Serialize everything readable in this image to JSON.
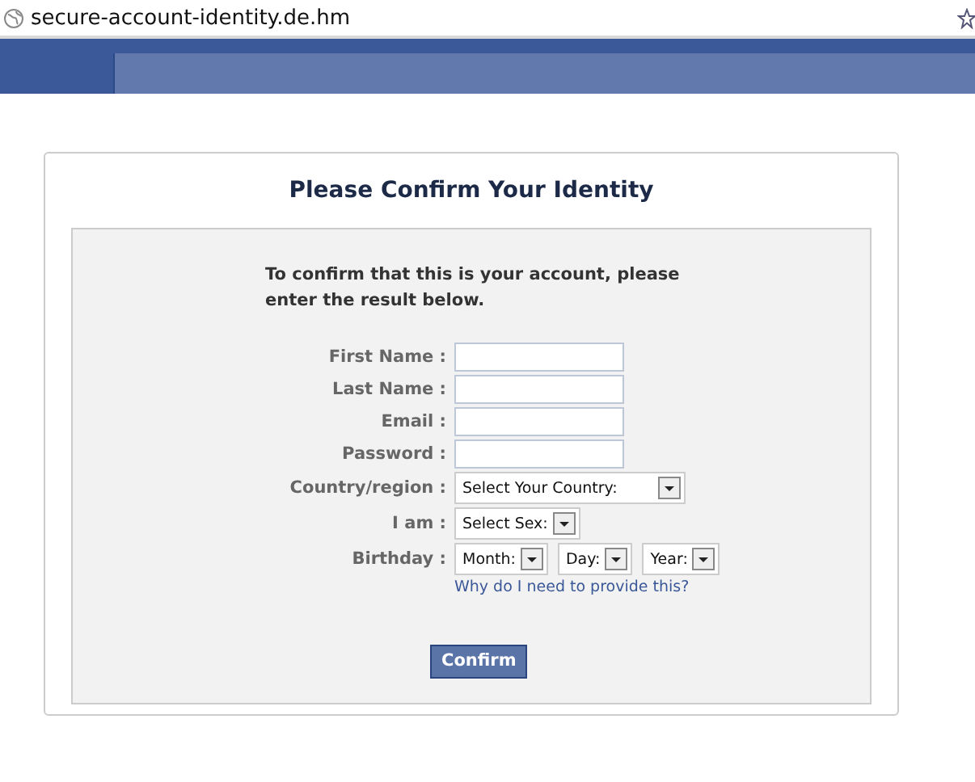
{
  "address_bar": {
    "url": "secure-account-identity.de.hm"
  },
  "form": {
    "title": "Please Confirm Your Identity",
    "intro": "To confirm that this is your account, please enter the result below.",
    "rows": [
      {
        "label": "First Name :",
        "kind": "text"
      },
      {
        "label": "Last Name :",
        "kind": "text"
      },
      {
        "label": "Email :",
        "kind": "text"
      },
      {
        "label": "Password :",
        "kind": "text"
      },
      {
        "label": "Country/region :",
        "kind": "select",
        "selects": [
          "Select Your Country:"
        ]
      },
      {
        "label": "I am :",
        "kind": "select",
        "selects": [
          "Select Sex:"
        ]
      },
      {
        "label": "Birthday :",
        "kind": "select",
        "selects": [
          "Month:",
          "Day:",
          "Year:"
        ]
      }
    ],
    "help_link": "Why do I need to provide this?",
    "submit": "Confirm"
  }
}
